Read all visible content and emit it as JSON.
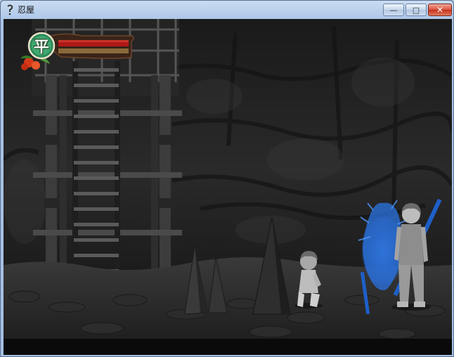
{
  "window": {
    "title": "忍屋",
    "controls": {
      "minimize": "—",
      "maximize": "□",
      "close": "✕"
    }
  },
  "hud": {
    "emblem_glyph": "平",
    "health_fraction": 1.0,
    "stamina_fraction": 1.0
  },
  "colors": {
    "titlebar": "#a9c4e6",
    "health": "#b01818",
    "stamina": "#8a6a3a",
    "ghost_spirit": "#2a6fd8"
  },
  "icons": [
    "app-icon",
    "minimize-icon",
    "maximize-icon",
    "close-icon",
    "emblem-icon"
  ]
}
